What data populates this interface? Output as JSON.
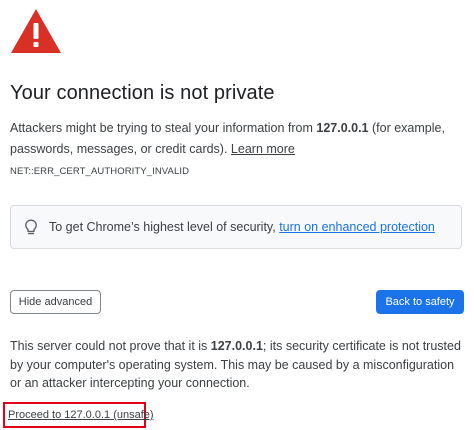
{
  "icons": {
    "warning": "warning-triangle-icon",
    "bulb": "lightbulb-icon"
  },
  "colors": {
    "warning_red": "#d93025",
    "link_blue": "#1a73e8",
    "primary_button": "#1a73e8",
    "highlight_border": "#e0001a"
  },
  "heading": {
    "title": "Your connection is not private"
  },
  "description": {
    "text_before": "Attackers might be trying to steal your information from ",
    "host": "127.0.0.1",
    "text_after": " (for example, passwords, messages, or credit cards). ",
    "learn_more": "Learn more"
  },
  "error_code": "NET::ERR_CERT_AUTHORITY_INVALID",
  "enhanced_protection": {
    "text": "To get Chrome’s highest level of security, ",
    "link": "turn on enhanced protection"
  },
  "buttons": {
    "hide_advanced": "Hide advanced",
    "back_to_safety": "Back to safety"
  },
  "details": {
    "text_before": "This server could not prove that it is ",
    "host": "127.0.0.1",
    "text_after": "; its security certificate is not trusted by your computer's operating system. This may be caused by a misconfiguration or an attacker intercepting your connection."
  },
  "proceed": {
    "label": "Proceed to 127.0.0.1 (unsafe)"
  }
}
